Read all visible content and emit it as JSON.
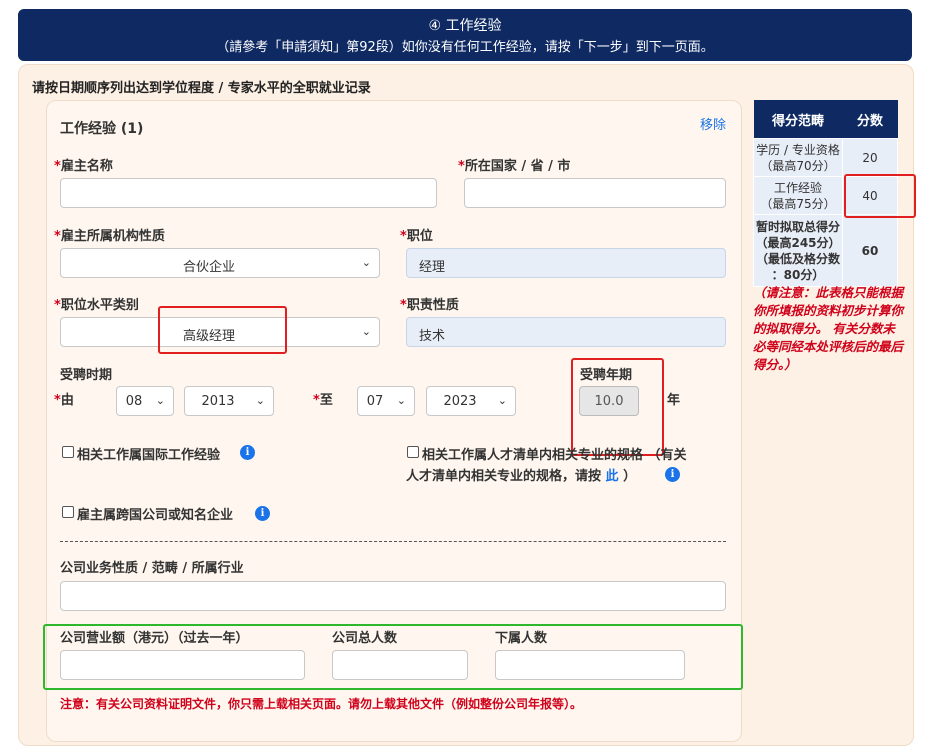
{
  "header": {
    "title": "④ 工作经验",
    "subtitle": "（請參考「申請須知」第92段）如你没有任何工作经验，请按「下一步」到下一页面。"
  },
  "intro": "请按日期顺序列出达到学位程度 / 专家水平的全职就业记录",
  "card": {
    "title": "工作经验 (1)",
    "remove_link": "移除",
    "employer_name_label": "雇主名称",
    "country_label": "所在国家 / 省 / 市",
    "employer_nature_label": "雇主所属机构性质",
    "employer_nature_value": "合伙企业",
    "position_label": "职位",
    "position_value": "经理",
    "position_level_label": "职位水平类别",
    "position_level_value": "高级经理",
    "duty_label": "职责性质",
    "duty_value": "技术",
    "period_label": "受聘时期",
    "from_label": "由",
    "from_month": "08",
    "from_year": "2013",
    "to_label": "至",
    "to_month": "07",
    "to_year": "2023",
    "years_label": "受聘年期",
    "years_value": "10.0",
    "years_unit": "年",
    "cb_international": "相关工作属国际工作经验",
    "cb_talent_line1": "相关工作属人才清单内相关专业的规格 （有关",
    "cb_talent_line2": "人才清单内相关专业的规格，请按",
    "cb_talent_link": "此",
    "cb_talent_end": "）",
    "cb_multinational": "雇主属跨国公司或知名企业",
    "business_label": "公司业务性质 / 范畴 / 所属行业",
    "turnover_label": "公司营业额（港元）（过去一年）",
    "employees_label": "公司总人数",
    "subordinates_label": "下属人数",
    "note": "注意：有关公司资料证明文件，你只需上载相关页面。请勿上载其他文件（例如整份公司年报等）。"
  },
  "score_table": {
    "header_range": "得分范畴",
    "header_score": "分数",
    "rows": [
      {
        "l1": "学历 / 专业资格",
        "l2": "（最高70分）",
        "score": "20"
      },
      {
        "l1": "工作经验",
        "l2": "（最高75分）",
        "score": "40"
      }
    ],
    "total_l1": "暂时拟取总得分",
    "total_l2": "（最高245分）",
    "total_l3": "（最低及格分数",
    "total_l4": "：80分）",
    "total_score": "60",
    "note": "（请注意：此表格只能根据你所填报的资料初步计算你的拟取得分。 有关分数未必等同经本处评核后的最后得分。）"
  }
}
